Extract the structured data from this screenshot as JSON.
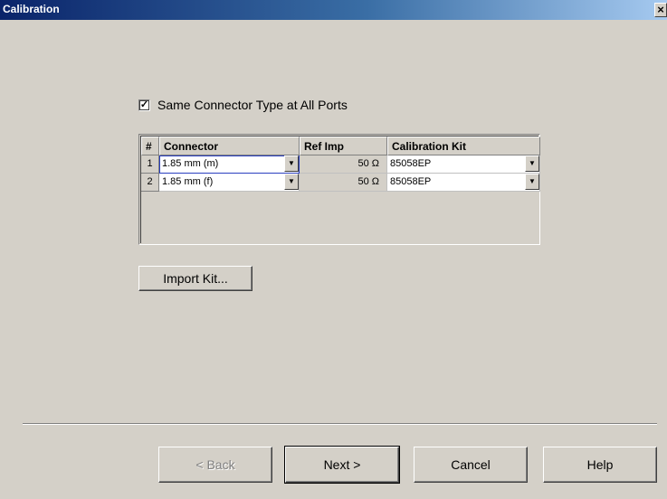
{
  "window": {
    "title": "Calibration",
    "close_glyph": "×"
  },
  "same_connector": {
    "checked": true,
    "check_glyph": "✓",
    "label": "Same Connector Type at All Ports"
  },
  "table": {
    "headers": [
      "#",
      "Connector",
      "Ref Imp",
      "Calibration Kit"
    ],
    "rows": [
      {
        "num": "1",
        "connector": "1.85 mm (m)",
        "ref_imp": "50 Ω",
        "kit": "85058EP"
      },
      {
        "num": "2",
        "connector": "1.85 mm (f)",
        "ref_imp": "50 Ω",
        "kit": "85058EP"
      }
    ],
    "dropdown_glyph": "▼"
  },
  "import_button": "Import Kit...",
  "footer": {
    "back": "< Back",
    "next": "Next >",
    "cancel": "Cancel",
    "help": "Help"
  }
}
